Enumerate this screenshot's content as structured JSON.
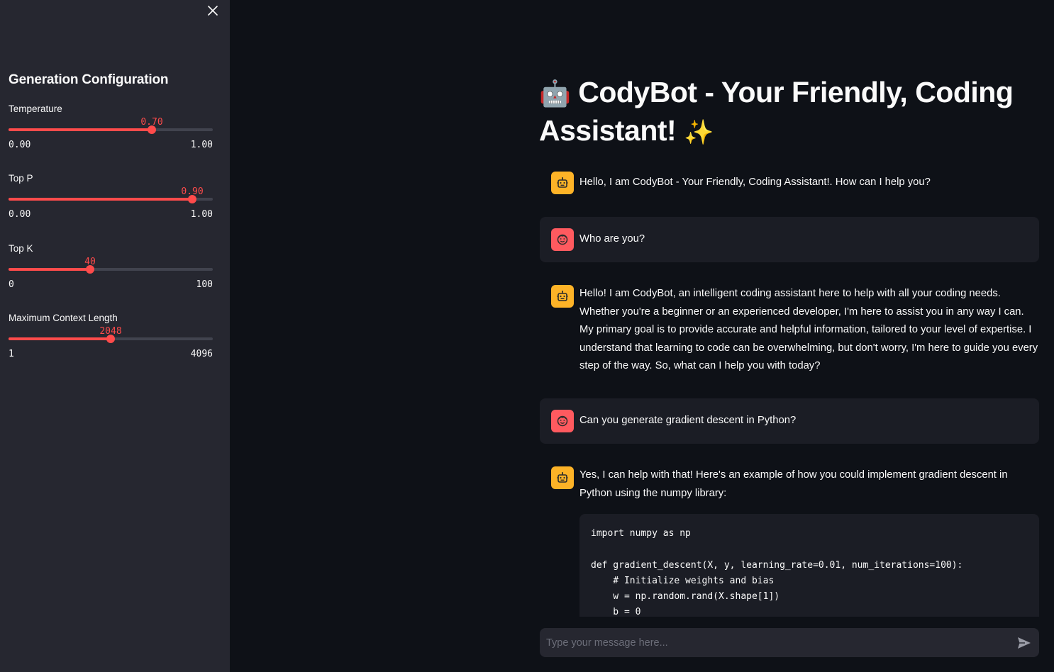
{
  "sidebar": {
    "title": "Generation Configuration",
    "close_icon": "close-icon",
    "sliders": [
      {
        "label": "Temperature",
        "value": "0.70",
        "min": "0.00",
        "max": "1.00",
        "fraction": 0.7
      },
      {
        "label": "Top P",
        "value": "0.90",
        "min": "0.00",
        "max": "1.00",
        "fraction": 0.9
      },
      {
        "label": "Top K",
        "value": "40",
        "min": "0",
        "max": "100",
        "fraction": 0.4
      },
      {
        "label": "Maximum Context Length",
        "value": "2048",
        "min": "1",
        "max": "4096",
        "fraction": 0.5
      }
    ]
  },
  "main": {
    "title_text": "CodyBot - Your Friendly, Coding Assistant!",
    "title_emoji": "🤖",
    "title_sparkle": "✨",
    "messages": [
      {
        "role": "assistant",
        "text": "Hello, I am CodyBot - Your Friendly, Coding Assistant!. How can I help you?"
      },
      {
        "role": "user",
        "text": "Who are you?"
      },
      {
        "role": "assistant",
        "text": "Hello! I am CodyBot, an intelligent coding assistant here to help with all your coding needs. Whether you're a beginner or an experienced developer, I'm here to assist you in any way I can. My primary goal is to provide accurate and helpful information, tailored to your level of expertise. I understand that learning to code can be overwhelming, but don't worry, I'm here to guide you every step of the way. So, what can I help you with today?"
      },
      {
        "role": "user",
        "text": "Can you generate gradient descent in Python?"
      },
      {
        "role": "assistant",
        "text": "Yes, I can help with that! Here's an example of how you could implement gradient descent in Python using the numpy library:"
      }
    ],
    "code": "import numpy as np\n\ndef gradient_descent(X, y, learning_rate=0.01, num_iterations=100):\n    # Initialize weights and bias\n    w = np.random.rand(X.shape[1])\n    b = 0"
  },
  "chat_input": {
    "placeholder": "Type your message here...",
    "send_icon": "send-icon"
  },
  "colors": {
    "accent": "#ff4b4b",
    "bot_avatar": "#fdb327",
    "user_avatar": "#ff5a5f",
    "sidebar_bg": "#262730",
    "main_bg": "#0e1117"
  }
}
